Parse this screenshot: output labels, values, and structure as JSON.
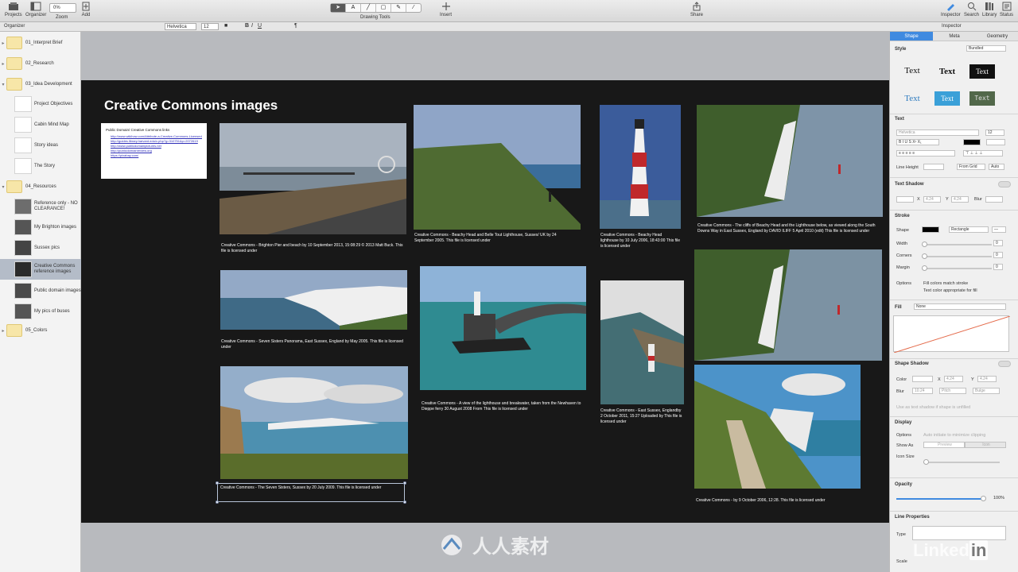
{
  "toolbar": {
    "projects": "Projects",
    "organizer": "Organizer",
    "zoom_value": "0%",
    "zoom_label": "Zoom",
    "add": "Add",
    "drawing_tools": "Drawing Tools",
    "insert": "Insert",
    "share": "Share",
    "inspector": "Inspector",
    "search": "Search",
    "library": "Library",
    "status": "Status"
  },
  "formatbar": {
    "organizer_title": "Organizer",
    "inspector_title": "Inspector",
    "font": "Helvetica",
    "size": "12",
    "bold": "B",
    "italic": "I",
    "underline": "U"
  },
  "organizer": [
    {
      "label": "01_Interpret Brief",
      "kind": "folder",
      "expanded": false
    },
    {
      "label": "02_Research",
      "kind": "folder",
      "expanded": false
    },
    {
      "label": "03_Idea Development",
      "kind": "folder",
      "expanded": true
    },
    {
      "label": "Project Objectives",
      "kind": "page"
    },
    {
      "label": "Cabin Mind Map",
      "kind": "page"
    },
    {
      "label": "Story ideas",
      "kind": "page"
    },
    {
      "label": "The Story",
      "kind": "page"
    },
    {
      "label": "04_Resources",
      "kind": "folder",
      "expanded": true
    },
    {
      "label": "Reference only - NO CLEARANCE!",
      "kind": "page"
    },
    {
      "label": "My Brighton images",
      "kind": "page"
    },
    {
      "label": "Sussex pics",
      "kind": "page"
    },
    {
      "label": "Creative Commons reference images",
      "kind": "page",
      "selected": true
    },
    {
      "label": "Public domain images",
      "kind": "page"
    },
    {
      "label": "My pics of buses",
      "kind": "page"
    },
    {
      "label": "05_Colors",
      "kind": "folder",
      "expanded": false
    }
  ],
  "board": {
    "title": "Creative Commons images",
    "links_title": "Public Domain/ Creative Commons links",
    "links": [
      "http://www.wikihow.com/Attribute-a-Creative-Commons-Licensed-Work",
      "http://guides.library.harvard.edu/c.php?g=310751&p=2072619",
      "http://www.publicdomainpictures.net",
      "http://publicdomainreview.org",
      "https://pixabay.com/"
    ],
    "captions": {
      "brighton": "Creative Commons - Brighton Pier and beach by 10 September 2013, 15:08:29 © 2013 Matt Buck. This file is licensed under",
      "beachy_belle": "Creative Commons - Beachy Head and Belle Tout Lighthouse, Sussex/ UK by 24 September 2005. This file is licensed under",
      "beachy_lighthouse": "Creative Commons - Beachy Head lighthouse by 10 July 2006, 18:43:00 This file is licensed under",
      "cliffs_beachy": "Creative Commons - The cliffs of Beachy Head and the Lighthouse below, as viewed along the South Downs Way in East Sussex, England by DAVID ILIFF 5 April 2010 (edit) This file is licensed under",
      "seven_sisters_panorama": "Creative Commons - Seven Sisters Panorama, East Sussex, England by May 2005. This file is licensed under",
      "newhaven": "Creative Commons - A view of the lighthouse and breakwater, taken from the Newhaven to Dieppe ferry 30 August 2008 From This file is licensed under",
      "east_sussex": "Creative Commons - East Sussex, Englandby 2 October 2011, 15:27 Uploaded by This file is licensed under",
      "seven_sisters": "Creative Commons - The Seven Sisters, Sussex by 20 July 2009. This file is licensed under",
      "footpath": "Creative Commons - by 9 October 2006, 12:28. This file is licensed under"
    }
  },
  "inspector": {
    "tabs": [
      "Shape",
      "Meta",
      "Geometry"
    ],
    "active_tab": "Shape",
    "style_label": "Style",
    "style_value": "Bundled",
    "style_sample": "Text",
    "text_section": "Text",
    "font": "Helvetica",
    "font_size": "12",
    "line_height": "Line Height",
    "from_grid": "From Grid",
    "auto": "Auto",
    "text_shadow": "Text Shadow",
    "x": "X",
    "y": "Y",
    "blur": "Blur",
    "stroke": "Stroke",
    "shape": "Shape",
    "rectangle": "Rectangle",
    "width": "Width",
    "corners": "Corners",
    "margin": "Margin",
    "zero": "0",
    "options": "Options",
    "fill_colors_match": "Fill colors match stroke",
    "text_color_fill": "Text color appropriate for fill",
    "fill": "Fill",
    "fill_value": "None",
    "shape_shadow": "Shape Shadow",
    "color": "Color",
    "offset_x": "4.24",
    "offset_y": "4.24",
    "blur_value": "10.24",
    "pitch": "Pitch",
    "bulge": "Bulge",
    "use_as_text_shadow": "Use as text shadow if shape is unfilled",
    "display": "Display",
    "auto_initiate": "Auto initiate to minimize clipping",
    "show_as": "Show As",
    "preview": "Preview",
    "icon": "Icon",
    "icon_size": "Icon Size",
    "opacity": "Opacity",
    "opacity_value": "100%",
    "line_properties": "Line Properties",
    "type": "Type",
    "scale": "Scale"
  },
  "watermark": {
    "cn_text": "人人素材",
    "linkedin_a": "Linked",
    "linkedin_b": "in"
  },
  "colors": {
    "accent": "#3f8ae0",
    "board": "#181818",
    "canvas": "#b8babe"
  }
}
